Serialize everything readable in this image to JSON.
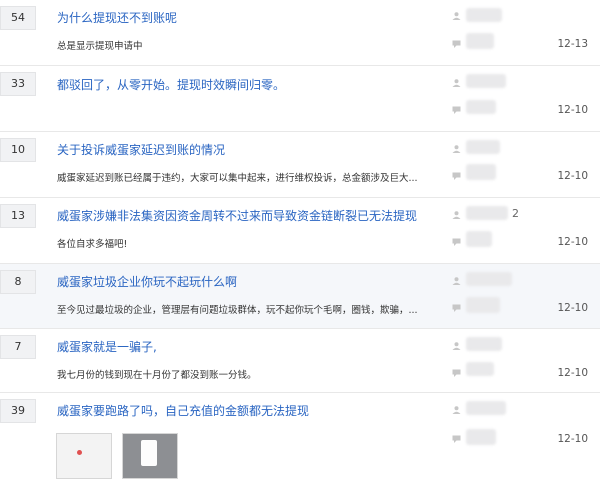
{
  "topics": [
    {
      "count": "54",
      "title": "为什么提现还不到账呢",
      "snippet": "总是显示提现申请中",
      "date": "12-13",
      "extra": ""
    },
    {
      "count": "33",
      "title": "都驳回了，从零开始。提现时效瞬间归零。",
      "snippet": "",
      "date": "12-10",
      "extra": ""
    },
    {
      "count": "10",
      "title": "关于投诉威蛋家延迟到账的情况",
      "snippet": "威蛋家延迟到账已经属于违约，大家可以集中起来，进行维权投诉，总金额涉及巨大...",
      "date": "12-10",
      "extra": ""
    },
    {
      "count": "13",
      "title": "威蛋家涉嫌非法集资因资金周转不过来而导致资金链断裂已无法提现",
      "snippet": "各位自求多福吧!",
      "date": "12-10",
      "extra": "2"
    },
    {
      "count": "8",
      "title": "威蛋家垃圾企业你玩不起玩什么啊",
      "snippet": "至今见过最垃圾的企业，管理层有问题垃圾群体，玩不起你玩个毛啊，圈钱，欺骗，...",
      "date": "12-10",
      "extra": ""
    },
    {
      "count": "7",
      "title": "威蛋家就是一骗子,",
      "snippet": "我七月份的钱到现在十月份了都没到账一分钱。",
      "date": "12-10",
      "extra": ""
    },
    {
      "count": "39",
      "title": "威蛋家要跑路了吗，自己充值的金额都无法提现",
      "snippet": "",
      "date": "12-10",
      "extra": ""
    }
  ],
  "icons": {
    "author": "user-icon",
    "reply": "comment-icon"
  }
}
